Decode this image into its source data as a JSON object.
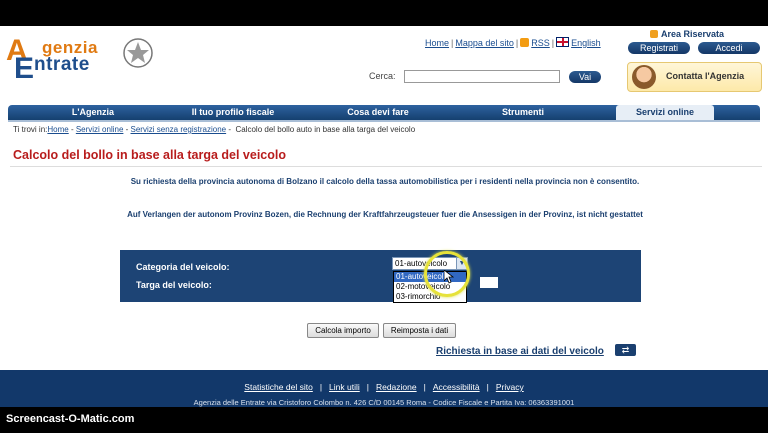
{
  "header": {
    "logo": {
      "line1": "genzia",
      "line2": "ntrate",
      "big1": "A",
      "big2": "E"
    },
    "top_links": [
      "Home",
      "Mappa del sito",
      "RSS",
      "English"
    ],
    "area_riservata": "Area Riservata",
    "registrati": "Registrati",
    "accedi": "Accedi",
    "search_label": "Cerca:",
    "search_value": "",
    "search_button": "Vai",
    "contatta": "Contatta l'Agenzia"
  },
  "nav": {
    "items": [
      "L'Agenzia",
      "Il tuo profilo fiscale",
      "Cosa devi fare",
      "Strumenti",
      "Servizi online"
    ],
    "active_index": 4
  },
  "breadcrumb": {
    "prefix": "Ti trovi in:",
    "links": [
      "Home",
      "Servizi online",
      "Servizi senza registrazione"
    ],
    "current": "Calcolo del bollo auto in base alla targa del veicolo"
  },
  "page_title": "Calcolo del bollo in base alla targa del veicolo",
  "messages": {
    "it": "Su richiesta della provincia autonoma di Bolzano il calcolo della tassa automobilistica per i residenti nella provincia non è consentito.",
    "de": "Auf Verlangen der autonom Provinz Bozen, die Rechnung der Kraftfahrzeugsteuer fuer die Ansessigen in der Provinz, ist nicht gestattet"
  },
  "form": {
    "categoria_label": "Categoria del veicolo:",
    "targa_label": "Targa del veicolo:",
    "categoria_selected": "01-autoveicolo",
    "options": [
      "01-autoveicolo",
      "02-motoveicolo",
      "03-rimorchio"
    ],
    "highlighted_option": 0,
    "calcola_button": "Calcola importo",
    "reimposta_button": "Reimposta i dati"
  },
  "richiesta_link": "Richiesta in base ai dati del veicolo",
  "footer": {
    "links": [
      "Statistiche del sito",
      "Link utili",
      "Redazione",
      "Accessibilità",
      "Privacy"
    ],
    "address": "Agenzia delle Entrate via Cristoforo Colombo n. 426 C/D 00145 Roma - Codice Fiscale e Partita Iva: 06363391001"
  },
  "screencast_brand": "Screencast-O-Matic.com"
}
